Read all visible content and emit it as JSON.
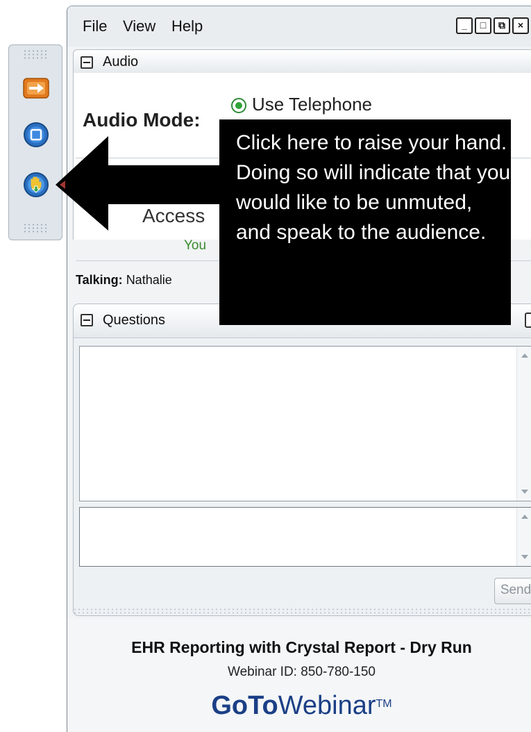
{
  "menu": {
    "file": "File",
    "view": "View",
    "help": "Help"
  },
  "audio": {
    "panel_title": "Audio",
    "mode_label": "Audio Mode:",
    "option_telephone": "Use Telephone",
    "access_partial": "Access",
    "you_partial": "You",
    "talking_label": "Talking:",
    "talking_name_partial": "Nathalie"
  },
  "questions": {
    "panel_title": "Questions",
    "send_label": "Send"
  },
  "footer": {
    "event_title": "EHR Reporting with Crystal Report - Dry Run",
    "webinar_id": "Webinar ID: 850-780-150",
    "brand_go": "GoTo",
    "brand_webinar": "Webinar",
    "brand_tm": "TM"
  },
  "callout": {
    "text": "Click here to raise your hand. Doing so will indicate that you would like to be unmuted, and speak to the audience."
  },
  "colors": {
    "brand": "#1b3f86",
    "accent_green": "#2fa33a",
    "callout_bg": "#000000"
  },
  "icons": [
    "arrow-right-icon",
    "stop-screen-icon",
    "raise-hand-icon"
  ]
}
